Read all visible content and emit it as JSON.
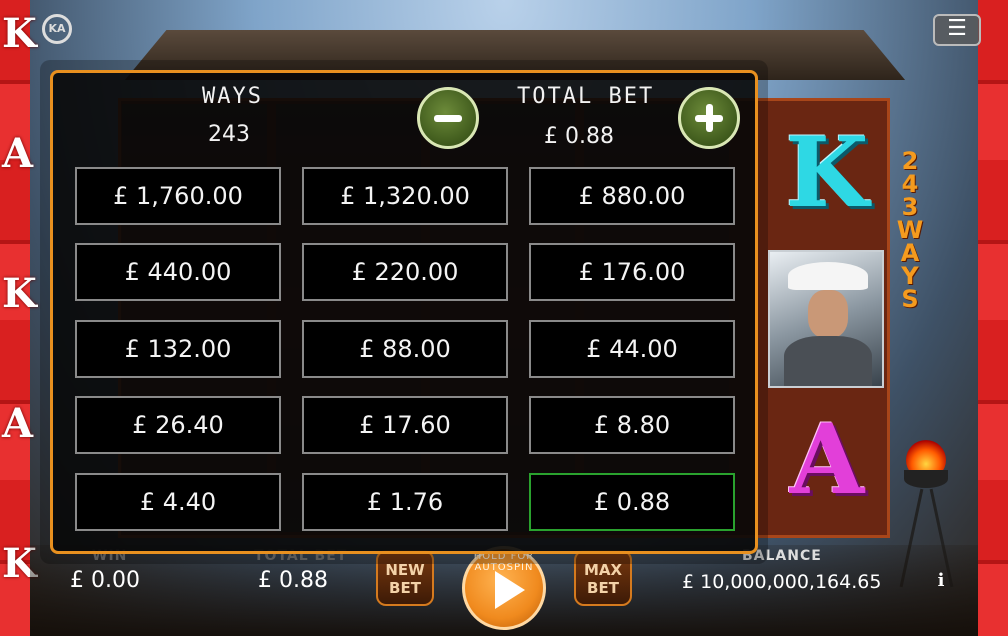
{
  "logo": {
    "text": "KA"
  },
  "menu": {
    "icon": "hamburger-menu-icon"
  },
  "reels": {
    "symbol_k": "K",
    "symbol_a": "A",
    "ways_banner": [
      "2",
      "4",
      "3",
      "W",
      "A",
      "Y",
      "S"
    ]
  },
  "side_letters": [
    "K",
    "A",
    "K",
    "A",
    "K"
  ],
  "bet_panel": {
    "ways_label": "WAYS",
    "ways_value": "243",
    "total_bet_label": "TOTAL BET",
    "total_bet_value": "£ 0.88",
    "decrease_icon": "minus-icon",
    "increase_icon": "plus-icon",
    "options": [
      "£ 1,760.00",
      "£ 1,320.00",
      "£ 880.00",
      "£ 440.00",
      "£ 220.00",
      "£ 176.00",
      "£ 132.00",
      "£ 88.00",
      "£ 44.00",
      "£ 26.40",
      "£ 17.60",
      "£ 8.80",
      "£ 4.40",
      "£ 1.76",
      "£ 0.88"
    ],
    "selected_option": "£ 0.88"
  },
  "bottom_bar": {
    "win_label": "WIN",
    "win_value": "£ 0.00",
    "total_bet_label": "TOTAL BET",
    "total_bet_value": "£ 0.88",
    "new_bet_label_1": "NEW",
    "new_bet_label_2": "BET",
    "spin_hint": "HOLD FOR AUTOSPIN",
    "max_bet_label_1": "MAX",
    "max_bet_label_2": "BET",
    "balance_label": "BALANCE",
    "balance_value": "£ 10,000,000,164.65",
    "info_icon": "i"
  },
  "colors": {
    "panel_border": "#e8901f",
    "selected_border": "#2aa22e",
    "round_button": "#4f6d26",
    "spin_button": "#f08a1e"
  }
}
